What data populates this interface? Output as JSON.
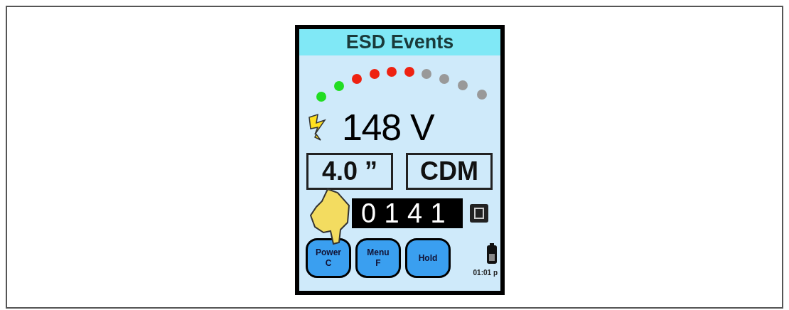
{
  "screen": {
    "title": "ESD Events",
    "leds": [
      {
        "color": "#22dd22"
      },
      {
        "color": "#22dd22"
      },
      {
        "color": "#ee2211"
      },
      {
        "color": "#ee2211"
      },
      {
        "color": "#ee2211"
      },
      {
        "color": "#ee2211"
      },
      {
        "color": "#999999"
      },
      {
        "color": "#999999"
      },
      {
        "color": "#999999"
      },
      {
        "color": "#999999"
      }
    ],
    "reading": "148 V",
    "fields": [
      "4.0 ”",
      "CDM"
    ],
    "counter": "0141",
    "buttons": [
      {
        "lines": [
          "Power",
          "C"
        ]
      },
      {
        "lines": [
          "Menu",
          "F"
        ]
      },
      {
        "lines": [
          "Hold"
        ]
      }
    ],
    "time": "01:01 p"
  }
}
